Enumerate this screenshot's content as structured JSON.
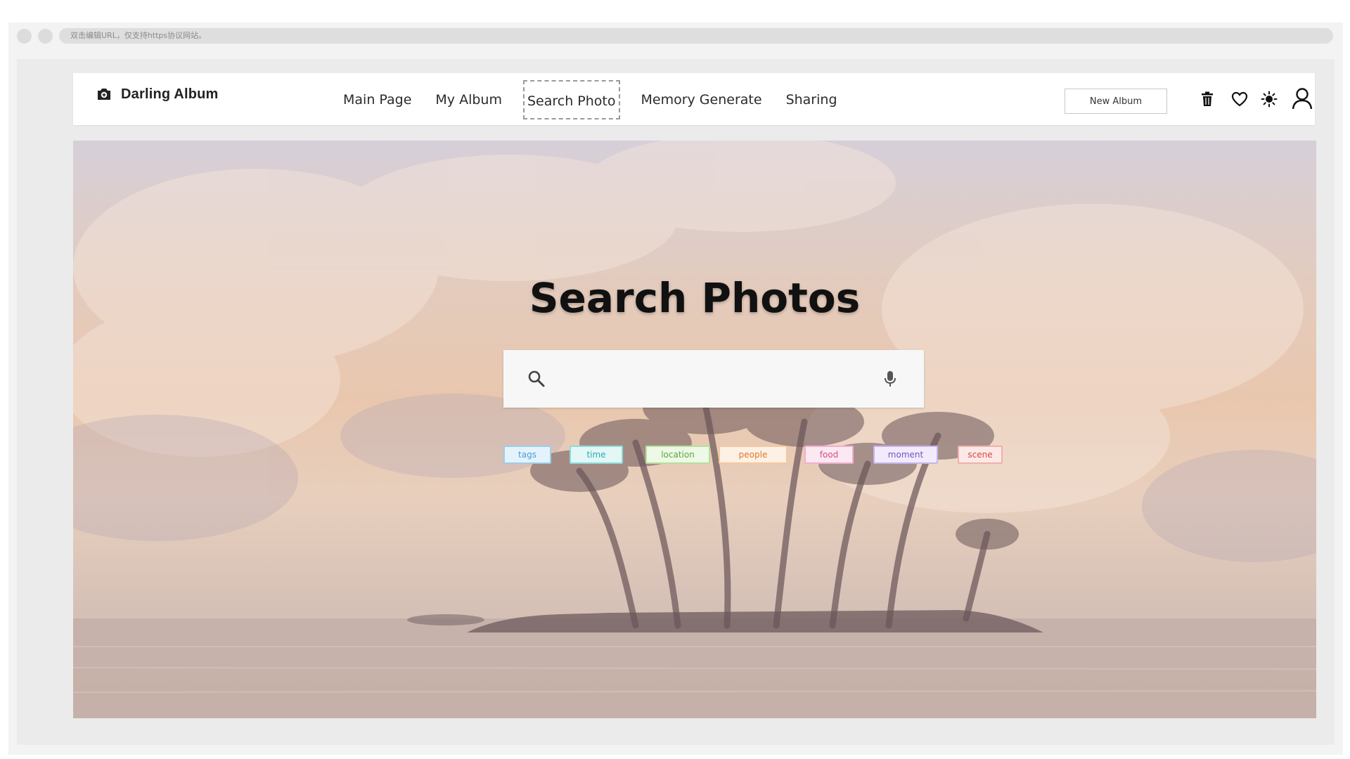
{
  "browser": {
    "address_text": "双击编辑URL，仅支持https协议网站。"
  },
  "navbar": {
    "brand": "Darling Album",
    "items": [
      {
        "label": "Main Page",
        "active": false
      },
      {
        "label": "My Album",
        "active": false
      },
      {
        "label": "Search Photo",
        "active": true
      },
      {
        "label": "Memory Generate",
        "active": false
      },
      {
        "label": "Sharing",
        "active": false
      }
    ],
    "new_album_label": "New Album",
    "icons": [
      "trash-icon",
      "heart-icon",
      "brightness-icon",
      "user-icon"
    ]
  },
  "hero": {
    "title": "Search Photos",
    "search": {
      "value": "",
      "placeholder": ""
    },
    "chips": [
      {
        "label": "tags",
        "color": "#4a9ad6",
        "bg": "#e4f3fb",
        "border": "#9ccdea"
      },
      {
        "label": "time",
        "color": "#2ba9b0",
        "bg": "#e2f7f6",
        "border": "#8edbd7"
      },
      {
        "label": "location",
        "color": "#5aa63a",
        "bg": "#eef8e6",
        "border": "#b5df9d"
      },
      {
        "label": "people",
        "color": "#e0782c",
        "bg": "#fdf0e4",
        "border": "#f5c79f"
      },
      {
        "label": "food",
        "color": "#d64a8e",
        "bg": "#fbe8f1",
        "border": "#f0aed0"
      },
      {
        "label": "moment",
        "color": "#7a4fc8",
        "bg": "#f1ebfb",
        "border": "#c8b3ee"
      },
      {
        "label": "scene",
        "color": "#d9463f",
        "bg": "#fce9e7",
        "border": "#f0b0aa"
      }
    ]
  }
}
